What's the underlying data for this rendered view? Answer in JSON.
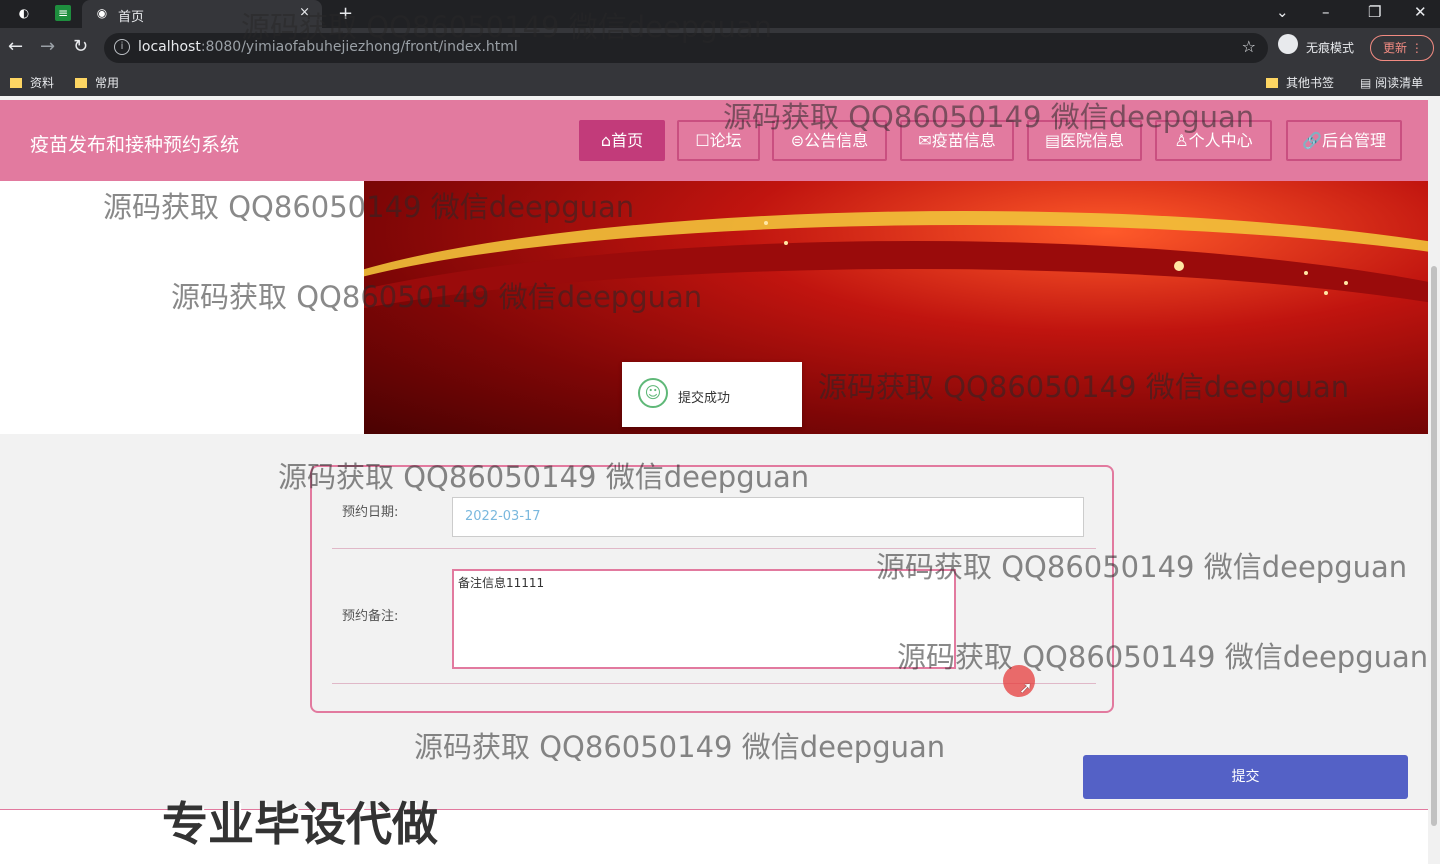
{
  "browser": {
    "tab_title": "首页",
    "tab_close": "×",
    "new_tab": "+",
    "url_host": "localhost",
    "url_path": ":8080/yimiaofabuhejiezhong/front/index.html",
    "incognito_label": "无痕模式",
    "update_label": "更新",
    "bookmarks": [
      "资料",
      "常用"
    ],
    "other_bookmarks": "其他书签",
    "reading_list": "阅读清单"
  },
  "site": {
    "title": "疫苗发布和接种预约系统",
    "nav": [
      {
        "label": "⌂首页"
      },
      {
        "label": "☐论坛"
      },
      {
        "label": "⊜公告信息"
      },
      {
        "label": "✉疫苗信息"
      },
      {
        "label": "▤医院信息"
      },
      {
        "label": "♙个人中心"
      },
      {
        "label": "🔗后台管理"
      }
    ]
  },
  "toast": {
    "text": "提交成功"
  },
  "form": {
    "date_label": "预约日期:",
    "date_value": "2022-03-17",
    "remark_label": "预约备注:",
    "remark_value": "备注信息11111",
    "submit_label": "提交"
  },
  "watermark": "源码获取 QQ86050149 微信deepguan",
  "promo": "专业毕设代做"
}
